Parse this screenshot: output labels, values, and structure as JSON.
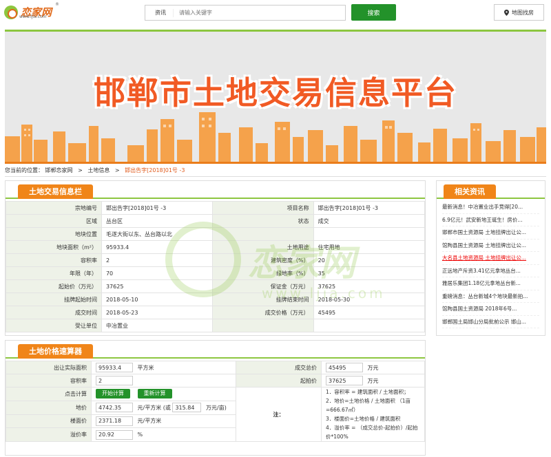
{
  "header": {
    "logo_text": "恋家网",
    "logo_url": "www.ljia.com",
    "search_type": "资讯",
    "search_placeholder": "请输入关键字",
    "search_button": "搜索",
    "map_button": "地图找房"
  },
  "banner": {
    "title": "邯郸市土地交易信息平台"
  },
  "breadcrumb": {
    "prefix": "您当前的位置：",
    "items": [
      "邯郸恋家网",
      "土地信息",
      "邯出告字[2018]01号 -3"
    ]
  },
  "land_info": {
    "title": "土地交易信息栏",
    "rows": [
      {
        "l1": "宗地编号",
        "v1": "邯出告字[2018]01号 -3",
        "l2": "项目名称",
        "v2": "邯出告字[2018]01号 -3"
      },
      {
        "l1": "区域",
        "v1": "丛台区",
        "l2": "状态",
        "v2": "成交"
      },
      {
        "l1": "地块位置",
        "v1": "毛遂大街以东、丛台路以北",
        "l2": "",
        "v2": ""
      },
      {
        "l1": "地块面积（m²）",
        "v1": "95933.4",
        "l2": "土地用途",
        "v2": "住宅用地"
      },
      {
        "l1": "容积率",
        "v1": "2",
        "l2": "建筑密度（%）",
        "v2": "20"
      },
      {
        "l1": "年限（年）",
        "v1": "70",
        "l2": "绿地率（%）",
        "v2": "35"
      },
      {
        "l1": "起始价（万元）",
        "v1": "37625",
        "l2": "保证金（万元）",
        "v2": "37625"
      },
      {
        "l1": "挂牌起始时间",
        "v1": "2018-05-10",
        "l2": "挂牌结束时间",
        "v2": "2018-05-30"
      },
      {
        "l1": "成交时间",
        "v1": "2018-05-23",
        "l2": "成交价格（万元）",
        "v2": "45495"
      },
      {
        "l1": "受让单位",
        "v1": "中冶置业",
        "l2": "",
        "v2": ""
      }
    ]
  },
  "watermark": {
    "text": "恋家网",
    "url": "www.ljia.com"
  },
  "calculator": {
    "title": "土地价格速算器",
    "area_label": "出让实际面积",
    "area_value": "95933.4",
    "area_unit": "平方米",
    "total_label": "成交总价",
    "total_value": "45495",
    "total_unit": "万元",
    "far_label": "容积率",
    "far_value": "2",
    "start_label": "起拍价",
    "start_value": "37625",
    "start_unit": "万元",
    "click_label": "点击计算",
    "calc_button": "开始计算",
    "reset_button": "重新计算",
    "land_price_label": "地价",
    "land_price_value": "4742.35",
    "land_price_unit": "元/平方米 (或",
    "land_price_mu_value": "315.84",
    "land_price_mu_unit": "万元/亩)",
    "floor_price_label": "楼面价",
    "floor_price_value": "2371.18",
    "floor_price_unit": "元/平方米",
    "premium_label": "溢价率",
    "premium_value": "20.92",
    "premium_unit": "%",
    "note_label": "注：",
    "notes": [
      "1．容积率 = 建筑面积 / 土地面积；",
      "2．地价=土地价格 / 土地面积 （1亩=666.67㎡）",
      "3．楼面价=土地价格 / 建筑面积",
      "4．溢价率 = （成交总价-起拍价）/起拍价*100%"
    ]
  },
  "related": {
    "title": "相关资讯",
    "items": [
      "最新消息！中冶置业出手竞得[20...",
      "6.9亿元！武安新地王诞生！房价...",
      "邯郸市国土资源局 土地挂牌出让公...",
      "馆陶县国土资源局 土地挂牌出让公...",
      "大名县土地资源局 土地挂牌出让公...",
      "正远地产斥资3.41亿元拿地丛台...",
      "雅居乐集团1.18亿元拿地丛台新...",
      "重磅消息：丛台新城4个地块最新拍...",
      "馆陶县国土资源局 2018年6号...",
      "邯郸国土局邯山分局批前公示 邯山..."
    ],
    "hot_index": 4
  },
  "colors": {
    "green": "#8cc63f",
    "dark_green": "#23922a",
    "orange": "#f08519",
    "link_red": "#e05a1b"
  }
}
